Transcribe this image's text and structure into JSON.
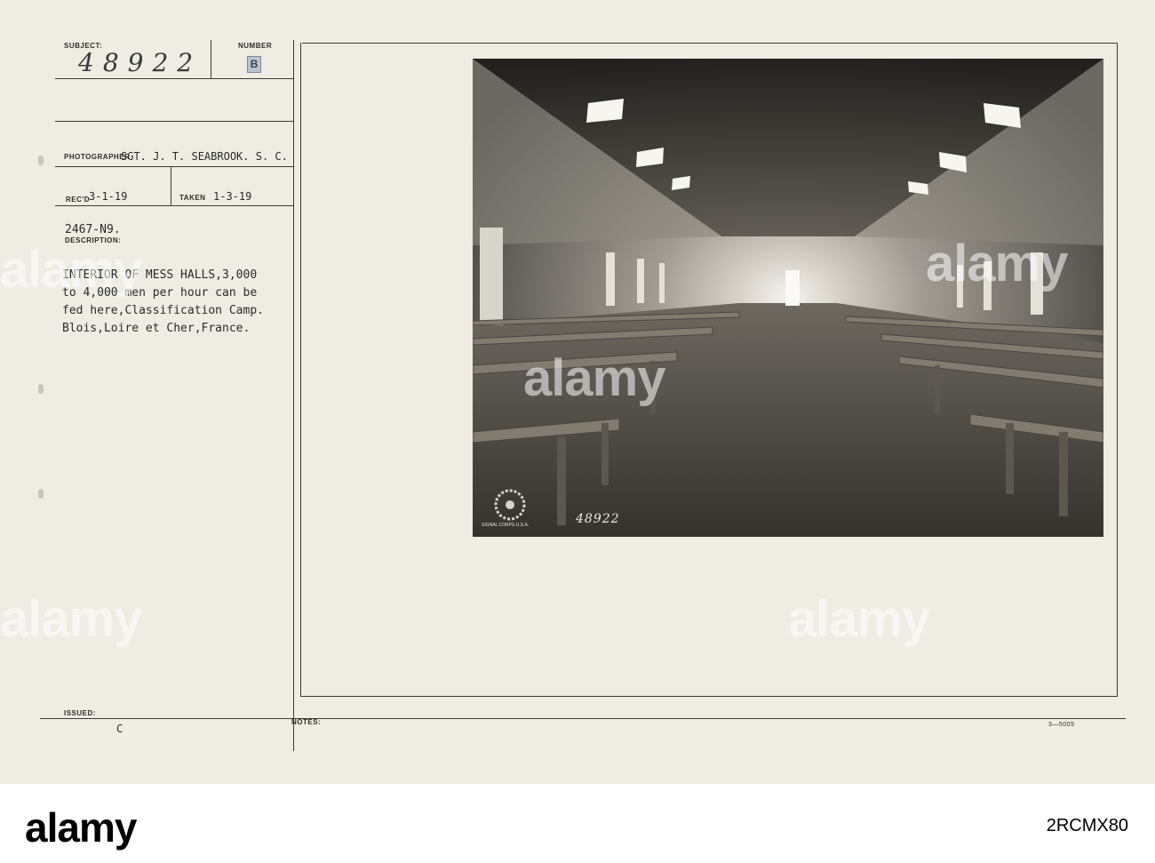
{
  "card": {
    "subject_label": "SUBJECT:",
    "subject_value": "48922",
    "number_label": "NUMBER",
    "number_value": "B",
    "photographer_label": "PHOTOGRAPHER",
    "photographer_value": "SGT. J. T. SEABROOK. S. C.",
    "recd_label": "REC'D",
    "recd_value": "3-1-19",
    "taken_label": "TAKEN",
    "taken_value": "1-3-19",
    "ref_number": "2467-N9.",
    "description_label": "DESCRIPTION:",
    "description_lines": [
      "INTERIOR OF MESS HALLS,3,000",
      "to 4,000 men per hour can be",
      "fed here,Classification Camp.",
      "Blois,Loire et Cher,France."
    ],
    "issued_label": "ISSUED:",
    "issued_value": "C",
    "notes_label": "NOTES:",
    "form_number": "3—5005"
  },
  "photo": {
    "negative_number": "48922",
    "stamp_text": "SIGNAL CORPS U.S.A."
  },
  "watermark": {
    "text": "alamy"
  },
  "footer": {
    "logo": "alamy",
    "image_id": "2RCMX80"
  },
  "colors": {
    "card": "#efece3",
    "ink": "#3d3a35",
    "footer": "#ffffff"
  }
}
